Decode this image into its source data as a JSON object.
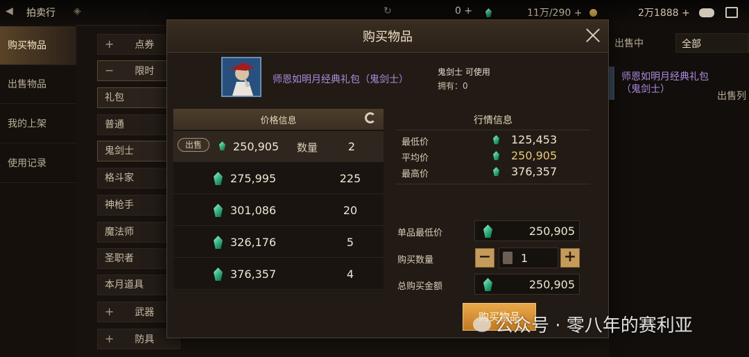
{
  "topbar": {
    "title": "拍卖行",
    "currency1": "0 +",
    "currency2": "11万/290 +",
    "currency3": "2万1888 +"
  },
  "leftnav": {
    "items": [
      "购买物品",
      "出售物品",
      "我的上架",
      "使用记录"
    ]
  },
  "categories": [
    {
      "sign": "+",
      "label": "点券"
    },
    {
      "sign": "−",
      "label": "限时"
    },
    {
      "sign": "",
      "label": "礼包"
    },
    {
      "sign": "",
      "label": "普通"
    },
    {
      "sign": "",
      "label": "鬼剑士"
    },
    {
      "sign": "",
      "label": "格斗家"
    },
    {
      "sign": "",
      "label": "神枪手"
    },
    {
      "sign": "",
      "label": "魔法师"
    },
    {
      "sign": "",
      "label": "圣职者"
    },
    {
      "sign": "",
      "label": "本月道具"
    },
    {
      "sign": "+",
      "label": "武器"
    },
    {
      "sign": "+",
      "label": "防具"
    }
  ],
  "rightbg": {
    "on_sale": "出售中",
    "filter": "全部",
    "item_name": "师恩如明月经典礼包（鬼剑士）",
    "sell_list": "出售列"
  },
  "modal": {
    "title": "购买物品",
    "item_name": "师恩如明月经典礼包（鬼剑士）",
    "usable": "鬼剑士 可使用",
    "owned": "拥有：0",
    "price_header": "价格信息",
    "sell_badge": "出售",
    "qty_label": "数量",
    "listings": [
      {
        "price": "250,905",
        "qty": "2"
      },
      {
        "price": "275,995",
        "qty": "225"
      },
      {
        "price": "301,086",
        "qty": "20"
      },
      {
        "price": "326,176",
        "qty": "5"
      },
      {
        "price": "376,357",
        "qty": "4"
      }
    ],
    "market": {
      "title": "行情信息",
      "min_label": "最低价",
      "min_value": "125,453",
      "avg_label": "平均价",
      "avg_value": "250,905",
      "max_label": "最高价",
      "max_value": "376,357"
    },
    "form": {
      "unit_min_label": "单品最低价",
      "unit_min_value": "250,905",
      "qty_label": "购买数量",
      "qty_value": "1",
      "total_label": "总购买金额",
      "total_value": "250,905"
    },
    "buy_button": "购买物品"
  },
  "watermark": "公众号 · 零八年的赛利亚",
  "colors": {
    "accent": "#c17a22",
    "gem": "#2fae79",
    "item_name": "#a98ce0",
    "avg_price": "#e8c77a"
  }
}
